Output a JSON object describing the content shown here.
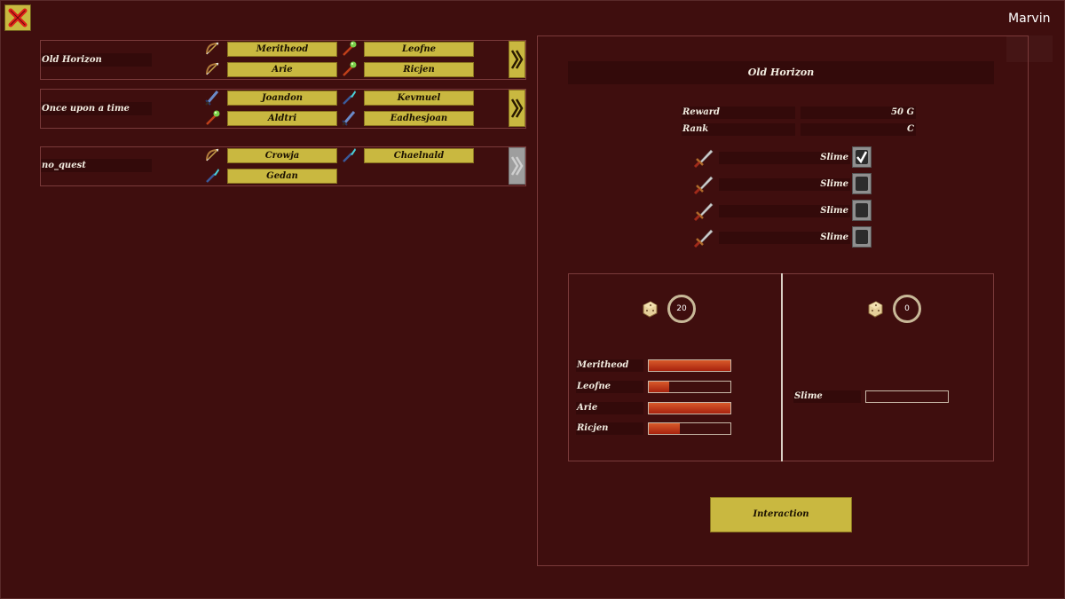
{
  "player": {
    "name": "Marvin"
  },
  "colors": {
    "background": "#3f0e0e",
    "button": "#c9b840",
    "panel_dark": "#330a0a",
    "hp_fill": "#c0361a"
  },
  "quests": [
    {
      "title": "Old Horizon",
      "members": [
        {
          "name": "Meritheod",
          "icon": "bow-icon"
        },
        {
          "name": "Leofne",
          "icon": "staff-icon"
        },
        {
          "name": "Arie",
          "icon": "bow-icon"
        },
        {
          "name": "Ricjen",
          "icon": "staff-icon"
        }
      ],
      "go_enabled": true
    },
    {
      "title": "Once upon a time",
      "members": [
        {
          "name": "Joandon",
          "icon": "dagger-icon"
        },
        {
          "name": "Kevmuel",
          "icon": "wand-icon"
        },
        {
          "name": "Aldtri",
          "icon": "staff-icon"
        },
        {
          "name": "Eadhesjoan",
          "icon": "dagger-icon"
        }
      ],
      "go_enabled": true
    },
    {
      "title": "no_quest",
      "members": [
        {
          "name": "Crowja",
          "icon": "bow-icon"
        },
        {
          "name": "Chaelnald",
          "icon": "wand-icon"
        },
        {
          "name": "Gedan",
          "icon": "wand-icon"
        }
      ],
      "go_enabled": false
    }
  ],
  "detail": {
    "title": "Old Horizon",
    "reward_label": "Reward",
    "reward_value": "50 G",
    "rank_label": "Rank",
    "rank_value": "C",
    "targets": [
      {
        "name": "Slime",
        "checked": true
      },
      {
        "name": "Slime",
        "checked": false
      },
      {
        "name": "Slime",
        "checked": false
      },
      {
        "name": "Slime",
        "checked": false
      }
    ]
  },
  "battle": {
    "party_power": "20",
    "enemy_power": "0",
    "party": [
      {
        "name": "Meritheod",
        "hp": 1.0
      },
      {
        "name": "Leofne",
        "hp": 0.25
      },
      {
        "name": "Arie",
        "hp": 1.0
      },
      {
        "name": "Ricjen",
        "hp": 0.38
      }
    ],
    "enemies": [
      {
        "name": "Slime",
        "hp": 0.0
      }
    ]
  },
  "action_label": "Interaction"
}
